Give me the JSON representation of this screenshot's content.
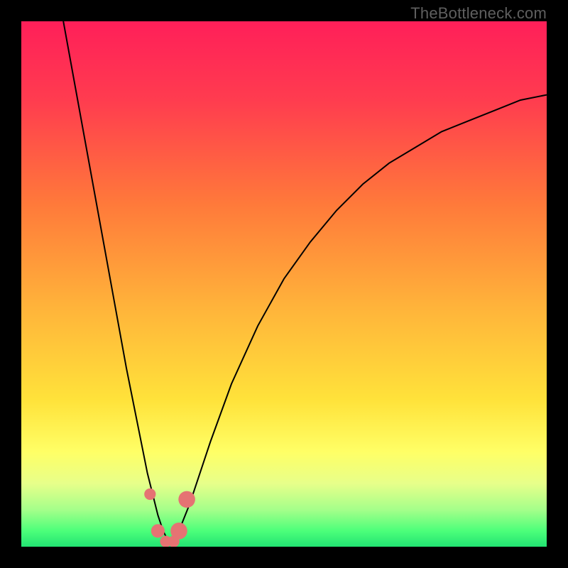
{
  "watermark": "TheBottleneck.com",
  "colors": {
    "frame_bg": "#000000",
    "gradient_stops": [
      {
        "offset": 0.0,
        "color": "#ff1f59"
      },
      {
        "offset": 0.15,
        "color": "#ff3c4f"
      },
      {
        "offset": 0.35,
        "color": "#ff7a3a"
      },
      {
        "offset": 0.55,
        "color": "#ffb53a"
      },
      {
        "offset": 0.72,
        "color": "#ffe23a"
      },
      {
        "offset": 0.82,
        "color": "#ffff66"
      },
      {
        "offset": 0.88,
        "color": "#e7ff8a"
      },
      {
        "offset": 0.93,
        "color": "#a4ff8a"
      },
      {
        "offset": 0.97,
        "color": "#4cff7a"
      },
      {
        "offset": 1.0,
        "color": "#22e372"
      }
    ],
    "curve": "#000000",
    "marker_fill": "#e57373",
    "marker_stroke": "#c95b5b"
  },
  "chart_data": {
    "type": "line",
    "title": "",
    "xlabel": "",
    "ylabel": "",
    "xlim": [
      0,
      100
    ],
    "ylim": [
      0,
      100
    ],
    "series": [
      {
        "name": "bottleneck-curve",
        "x": [
          8,
          10,
          12,
          14,
          16,
          18,
          20,
          22,
          24,
          26,
          27,
          28,
          29,
          30,
          32,
          34,
          36,
          40,
          45,
          50,
          55,
          60,
          65,
          70,
          75,
          80,
          85,
          90,
          95,
          100
        ],
        "y": [
          100,
          89,
          78,
          67,
          56,
          45,
          34,
          24,
          14,
          6,
          3,
          1,
          1,
          3,
          8,
          14,
          20,
          31,
          42,
          51,
          58,
          64,
          69,
          73,
          76,
          79,
          81,
          83,
          85,
          86
        ]
      }
    ],
    "markers": [
      {
        "name": "pt-left-upper",
        "x": 24.5,
        "y": 10,
        "r": 1.1
      },
      {
        "name": "pt-left-lower",
        "x": 26.0,
        "y": 3,
        "r": 1.3
      },
      {
        "name": "pt-bottom-1",
        "x": 27.5,
        "y": 1,
        "r": 1.1
      },
      {
        "name": "pt-bottom-2",
        "x": 29.0,
        "y": 1,
        "r": 1.1
      },
      {
        "name": "pt-right-lower",
        "x": 30.0,
        "y": 3,
        "r": 1.6
      },
      {
        "name": "pt-right-upper",
        "x": 31.5,
        "y": 9,
        "r": 1.6
      }
    ]
  }
}
